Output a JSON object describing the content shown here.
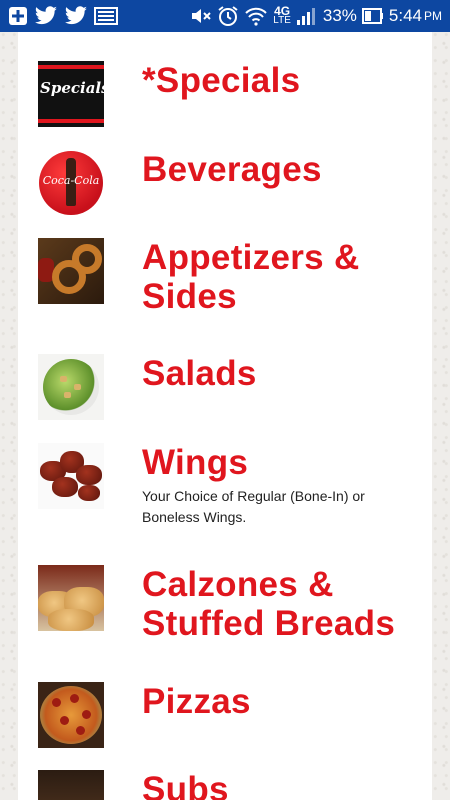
{
  "status_bar": {
    "battery_percent": "33%",
    "time": "5:44",
    "ampm": "PM",
    "network": "4G",
    "network_sub": "LTE"
  },
  "menu": {
    "items": [
      {
        "title": "*Specials",
        "title_line2": "",
        "description": "",
        "thumb_label": "Specials"
      },
      {
        "title": "Beverages",
        "title_line2": "",
        "description": "",
        "thumb_label": "Coca-Cola"
      },
      {
        "title": "Appetizers &",
        "title_line2": "Sides",
        "description": ""
      },
      {
        "title": "Salads",
        "title_line2": "",
        "description": ""
      },
      {
        "title": "Wings",
        "title_line2": "",
        "description": "Your Choice of Regular (Bone-In) or Boneless Wings."
      },
      {
        "title": "Calzones &",
        "title_line2": "Stuffed Breads",
        "description": ""
      },
      {
        "title": "Pizzas",
        "title_line2": "",
        "description": ""
      },
      {
        "title": "Subs",
        "title_line2": "",
        "description": ""
      }
    ]
  },
  "colors": {
    "title_red": "#e0161e",
    "status_bar_blue": "#0d47a1"
  }
}
